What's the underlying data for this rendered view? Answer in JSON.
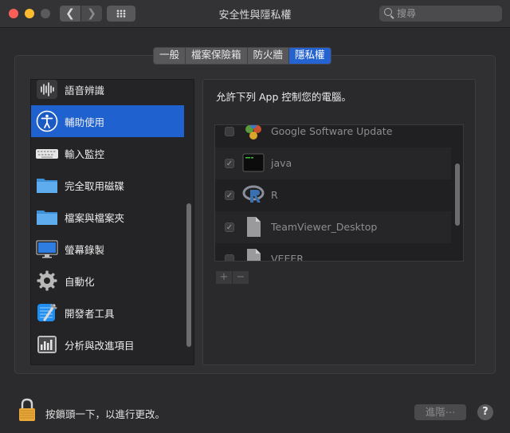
{
  "window": {
    "title": "安全性與隱私權"
  },
  "toolbar": {
    "back_glyph": "❮",
    "forward_glyph": "❯",
    "search_placeholder": "搜尋"
  },
  "tabs": [
    {
      "label": "一般",
      "active": false
    },
    {
      "label": "檔案保險箱",
      "active": false
    },
    {
      "label": "防火牆",
      "active": false
    },
    {
      "label": "隱私權",
      "active": true
    }
  ],
  "sidebar": {
    "items": [
      {
        "label": "語音辨識",
        "icon": "speech-recognition-icon",
        "selected": false
      },
      {
        "label": "輔助使用",
        "icon": "accessibility-icon",
        "selected": true
      },
      {
        "label": "輸入監控",
        "icon": "keyboard-icon",
        "selected": false
      },
      {
        "label": "完全取用磁碟",
        "icon": "folder-icon",
        "selected": false
      },
      {
        "label": "檔案與檔案夾",
        "icon": "folder-icon",
        "selected": false
      },
      {
        "label": "螢幕錄製",
        "icon": "monitor-icon",
        "selected": false
      },
      {
        "label": "自動化",
        "icon": "gear-icon",
        "selected": false
      },
      {
        "label": "開發者工具",
        "icon": "xcode-icon",
        "selected": false
      },
      {
        "label": "分析與改進項目",
        "icon": "analytics-icon",
        "selected": false
      }
    ]
  },
  "panel": {
    "title": "允許下列 App 控制您的電腦。",
    "apps": [
      {
        "name": "Google Software Update",
        "checked": false,
        "icon": "google-update-icon"
      },
      {
        "name": "java",
        "checked": true,
        "icon": "terminal-icon"
      },
      {
        "name": "R",
        "checked": true,
        "icon": "r-icon"
      },
      {
        "name": "TeamViewer_Desktop",
        "checked": true,
        "icon": "document-icon"
      },
      {
        "name": "VEEER",
        "checked": false,
        "icon": "document-icon"
      }
    ],
    "add_label": "+",
    "remove_label": "−"
  },
  "footer": {
    "lock_text": "按鎖頭一下，以進行更改。",
    "advanced_label": "進階⋯",
    "help_label": "?"
  },
  "colors": {
    "accent": "#2463d0",
    "window_bg": "#2b2b2d"
  }
}
